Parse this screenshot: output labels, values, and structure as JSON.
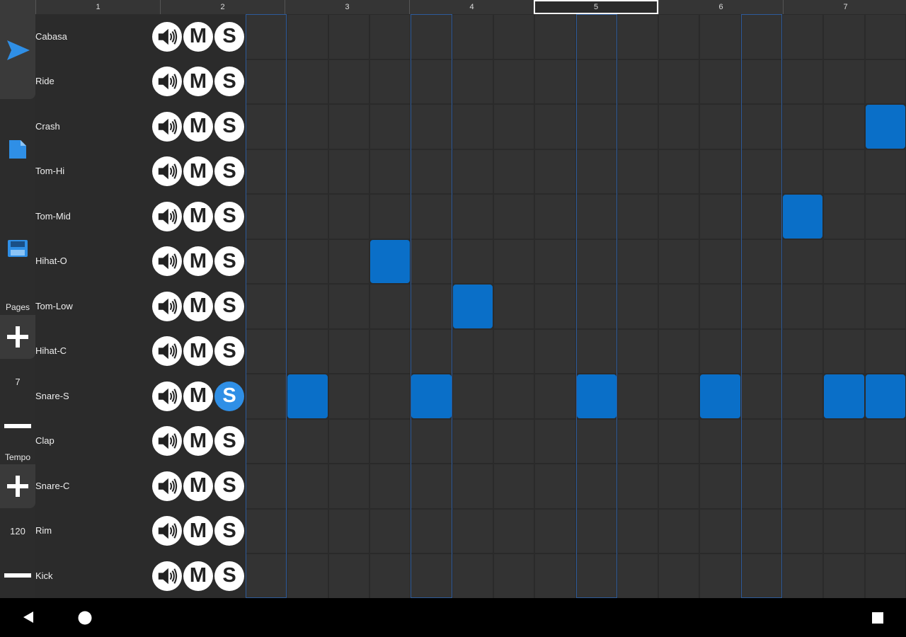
{
  "sidebar": {
    "pages_label": "Pages",
    "pages_value": "7",
    "tempo_label": "Tempo",
    "tempo_value": "120"
  },
  "ruler": {
    "pages": [
      "1",
      "2",
      "3",
      "4",
      "5",
      "6",
      "7"
    ],
    "current_page": 5
  },
  "tracks": [
    {
      "name": "Cabasa",
      "mute": "M",
      "solo": "S",
      "solo_active": false
    },
    {
      "name": "Ride",
      "mute": "M",
      "solo": "S",
      "solo_active": false
    },
    {
      "name": "Crash",
      "mute": "M",
      "solo": "S",
      "solo_active": false
    },
    {
      "name": "Tom-Hi",
      "mute": "M",
      "solo": "S",
      "solo_active": false
    },
    {
      "name": "Tom-Mid",
      "mute": "M",
      "solo": "S",
      "solo_active": false
    },
    {
      "name": "Hihat-O",
      "mute": "M",
      "solo": "S",
      "solo_active": false
    },
    {
      "name": "Tom-Low",
      "mute": "M",
      "solo": "S",
      "solo_active": false
    },
    {
      "name": "Hihat-C",
      "mute": "M",
      "solo": "S",
      "solo_active": false
    },
    {
      "name": "Snare-S",
      "mute": "M",
      "solo": "S",
      "solo_active": true
    },
    {
      "name": "Clap",
      "mute": "M",
      "solo": "S",
      "solo_active": false
    },
    {
      "name": "Snare-C",
      "mute": "M",
      "solo": "S",
      "solo_active": false
    },
    {
      "name": "Rim",
      "mute": "M",
      "solo": "S",
      "solo_active": false
    },
    {
      "name": "Kick",
      "mute": "M",
      "solo": "S",
      "solo_active": false
    }
  ],
  "steps": 16,
  "active_steps": [
    [
      2,
      15
    ],
    [
      4,
      13
    ],
    [
      5,
      3
    ],
    [
      6,
      5
    ],
    [
      8,
      1
    ],
    [
      8,
      4
    ],
    [
      8,
      8
    ],
    [
      8,
      11
    ],
    [
      8,
      14
    ],
    [
      8,
      15
    ]
  ],
  "colors": {
    "accent": "#0a6fc8",
    "solo_active": "#2f8fe6",
    "background": "#2b2b2b"
  }
}
